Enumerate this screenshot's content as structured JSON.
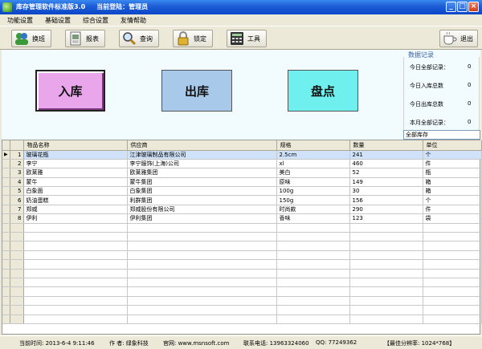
{
  "window": {
    "title": "库存管理软件标准版3.0     当前登陆：管理员"
  },
  "menu": [
    "功能设置",
    "基础设置",
    "综合设置",
    "友情帮助"
  ],
  "toolbar": {
    "shift": "换班",
    "report": "报表",
    "query": "查询",
    "lock": "锁定",
    "tools": "工具",
    "exit": "退出"
  },
  "actions": {
    "stock_in": "入库",
    "stock_out": "出库",
    "inventory": "盘点"
  },
  "stats": {
    "title": "数据记录",
    "rows": [
      {
        "label": "今日全部记录：",
        "value": "0"
      },
      {
        "label": "今日入库总数",
        "value": "0"
      },
      {
        "label": "今日出库总数",
        "value": "0"
      },
      {
        "label": "本月全部记录：",
        "value": "0"
      }
    ],
    "filter_value": "全部库存"
  },
  "table": {
    "columns": [
      "物品名称",
      "供应商",
      "规格",
      "数量",
      "单位"
    ],
    "rows": [
      {
        "no": "1",
        "name": "玻璃花瓶",
        "supplier": "江津玻璃制品有限公司",
        "spec": "2.5cm",
        "qty": "241",
        "unit": "个"
      },
      {
        "no": "2",
        "name": "李宁",
        "supplier": "李宁服饰(上海)公司",
        "spec": "xl",
        "qty": "460",
        "unit": "件"
      },
      {
        "no": "3",
        "name": "欧莱雅",
        "supplier": "欧莱雅集团",
        "spec": "美白",
        "qty": "52",
        "unit": "瓶"
      },
      {
        "no": "4",
        "name": "蒙牛",
        "supplier": "蒙牛集团",
        "spec": "原味",
        "qty": "149",
        "unit": "箱"
      },
      {
        "no": "5",
        "name": "白象面",
        "supplier": "白象集团",
        "spec": "100g",
        "qty": "30",
        "unit": "箱"
      },
      {
        "no": "6",
        "name": "奶油蛋糕",
        "supplier": "利群集团",
        "spec": "150g",
        "qty": "156",
        "unit": "个"
      },
      {
        "no": "7",
        "name": "郑威",
        "supplier": "郑威股份有限公司",
        "spec": "时尚款",
        "qty": "290",
        "unit": "件"
      },
      {
        "no": "8",
        "name": "伊利",
        "supplier": "伊利集团",
        "spec": "香味",
        "qty": "123",
        "unit": "袋"
      }
    ]
  },
  "status": {
    "time": "当前时间:    2013-6-4  9:11:46",
    "author": "作  者: 绿象科技",
    "website": "官网: www.msnsoft.com",
    "phone": "联系电话: 13963324060",
    "qq": "QQ: 77249362",
    "resolution": "【最佳分辨率: 1024*768】"
  }
}
